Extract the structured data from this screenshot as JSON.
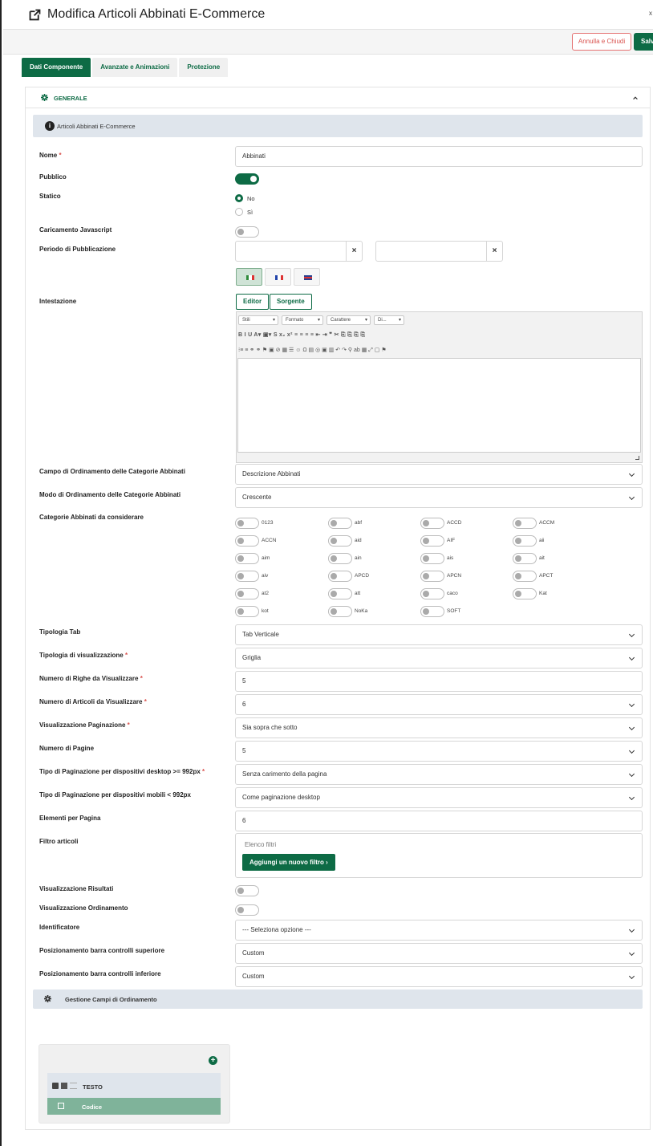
{
  "title": "Modifica Articoli Abbinati E-Commerce",
  "close_mark": "x",
  "actions": {
    "cancel": "Annulla e Chiudi",
    "save": "Salva"
  },
  "tabs": [
    {
      "label": "Dati Componente"
    },
    {
      "label": "Avanzate e Animazioni"
    },
    {
      "label": "Protezione"
    }
  ],
  "section": {
    "label": "GENERALE"
  },
  "info": {
    "text": "Articoli Abbinati E-Commerce",
    "icon": "i"
  },
  "fields": {
    "nome": {
      "label": "Nome",
      "req": "*",
      "value": "Abbinati"
    },
    "pubblico": {
      "label": "Pubblico"
    },
    "statico": {
      "label": "Statico",
      "opt_no": "No",
      "opt_si": "Sì"
    },
    "js": {
      "label": "Caricamento Javascript"
    },
    "periodo": {
      "label": "Periodo di Pubblicazione",
      "clear": "×"
    },
    "intestazione": {
      "label": "Intestazione"
    },
    "campo_ord": {
      "label": "Campo di Ordinamento delle Categorie Abbinati",
      "value": "Descrizione Abbinati"
    },
    "modo_ord": {
      "label": "Modo di Ordinamento delle Categorie Abbinati",
      "value": "Crescente"
    },
    "categorie": {
      "label": "Categorie Abbinati da considerare"
    },
    "tipologia_tab": {
      "label": "Tipologia Tab",
      "value": "Tab Verticale"
    },
    "tipologia_vis": {
      "label": "Tipologia di visualizzazione",
      "req": "*",
      "value": "Griglia"
    },
    "righe": {
      "label": "Numero di Righe da Visualizzare",
      "req": "*",
      "value": "5"
    },
    "articoli": {
      "label": "Numero di Articoli da Visualizzare",
      "req": "*",
      "value": "6"
    },
    "vis_pag": {
      "label": "Visualizzazione Paginazione",
      "req": "*",
      "value": "Sia sopra che sotto"
    },
    "num_pag": {
      "label": "Numero di Pagine",
      "value": "5"
    },
    "tipo_pag_desk": {
      "label": "Tipo di Paginazione per dispositivi desktop >= 992px",
      "req": "*",
      "value": "Senza carimento della pagina"
    },
    "tipo_pag_mob": {
      "label": "Tipo di Paginazione per dispositivi mobili < 992px",
      "value": "Come paginazione desktop"
    },
    "elementi": {
      "label": "Elementi per Pagina",
      "value": "6"
    },
    "filtro": {
      "label": "Filtro articoli",
      "list_label": "Elenco filtri",
      "add_btn": "Aggiungi un nuovo filtro"
    },
    "vis_risultati": {
      "label": "Visualizzazione Risultati"
    },
    "vis_ord": {
      "label": "Visualizzazione Ordinamento"
    },
    "identificatore": {
      "label": "Identificatore",
      "value": "--- Seleziona opzione ---"
    },
    "pos_sup": {
      "label": "Posizionamento barra controlli superiore",
      "value": "Custom"
    },
    "pos_inf": {
      "label": "Posizionamento barra controlli inferiore",
      "value": "Custom"
    }
  },
  "editor": {
    "btn_editor": "Editor",
    "btn_source": "Sorgente",
    "combos": [
      "Stili",
      "Formato",
      "Carattere",
      "Di..."
    ],
    "row2": "B  I  U  A▾  ▣▾  S  x₂  x²  ≡  ≡  ≡  ≡  ⇤  ⇥  ❞  ✂  ⎘  ⎘  ⎘  ⎘",
    "row3": "⁝≡  ≡  ⚭  ⚭  ⚑  ▣  ⊘  ▦  ☰  ☺  Ω  ▤  ◎  ▣  ▥  ↶  ↷  ⚲  ab  ▦  ⤢  ▢  ⚑"
  },
  "categories": [
    "0123",
    "abf",
    "ACCD",
    "ACCM",
    "ACCN",
    "aid",
    "AIF",
    "aii",
    "aim",
    "ain",
    "ais",
    "ait",
    "aiv",
    "APCD",
    "APCN",
    "APCT",
    "at2",
    "att",
    "caco",
    "Kat",
    "kot",
    "NoKa",
    "SOFT"
  ],
  "sorting_bar": {
    "label": "Gestione Campi di Ordinamento"
  },
  "tree": {
    "plus": "+",
    "row1": "TESTO",
    "row2": "Codice"
  },
  "colors": {
    "accent": "#0d6b45",
    "danger": "#d9534f",
    "info_bg": "#dfe5ec"
  }
}
